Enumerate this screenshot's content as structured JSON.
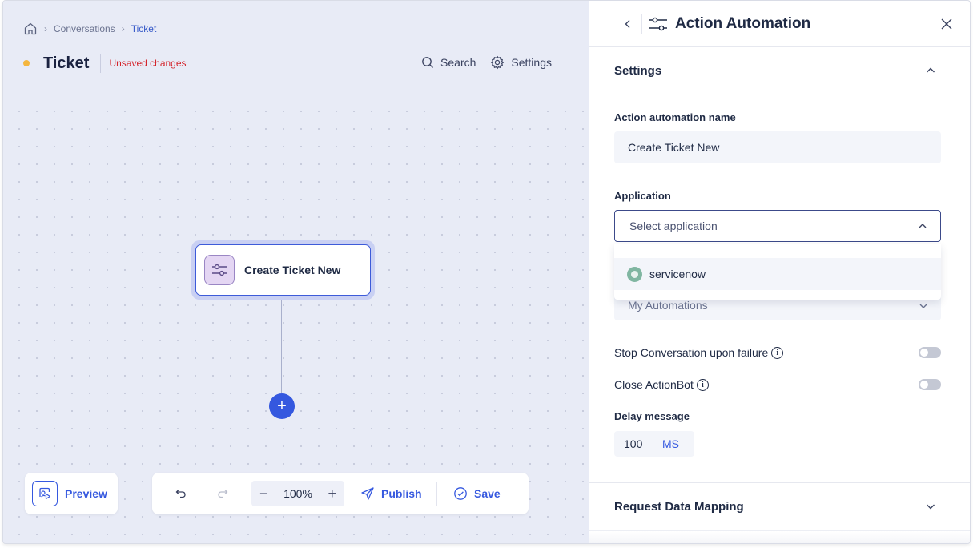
{
  "breadcrumb": {
    "home_icon": "home-icon",
    "items": [
      "Conversations",
      "Ticket"
    ]
  },
  "header": {
    "title": "Ticket",
    "status": "Unsaved changes",
    "search_label": "Search",
    "settings_label": "Settings"
  },
  "canvas": {
    "node_label": "Create Ticket New",
    "add_symbol": "+"
  },
  "bottom": {
    "preview_label": "Preview",
    "zoom_minus": "−",
    "zoom_value": "100%",
    "zoom_plus": "+",
    "publish_label": "Publish",
    "save_label": "Save"
  },
  "panel": {
    "title": "Action Automation",
    "settings_section": "Settings",
    "name_label": "Action automation name",
    "name_value": "Create Ticket New",
    "application_label": "Application",
    "application_placeholder": "Select application",
    "dropdown_option": "servicenow",
    "automation_value": "My Automations",
    "stop_label": "Stop Conversation upon failure",
    "close_label": "Close ActionBot",
    "delay_label": "Delay message",
    "delay_value": "100",
    "delay_unit": "MS",
    "mapping_section": "Request Data Mapping"
  },
  "colors": {
    "accent": "#3558df",
    "unsaved": "#d4242b",
    "status_dot": "#f4b63f",
    "highlight": "#3a70e0"
  }
}
